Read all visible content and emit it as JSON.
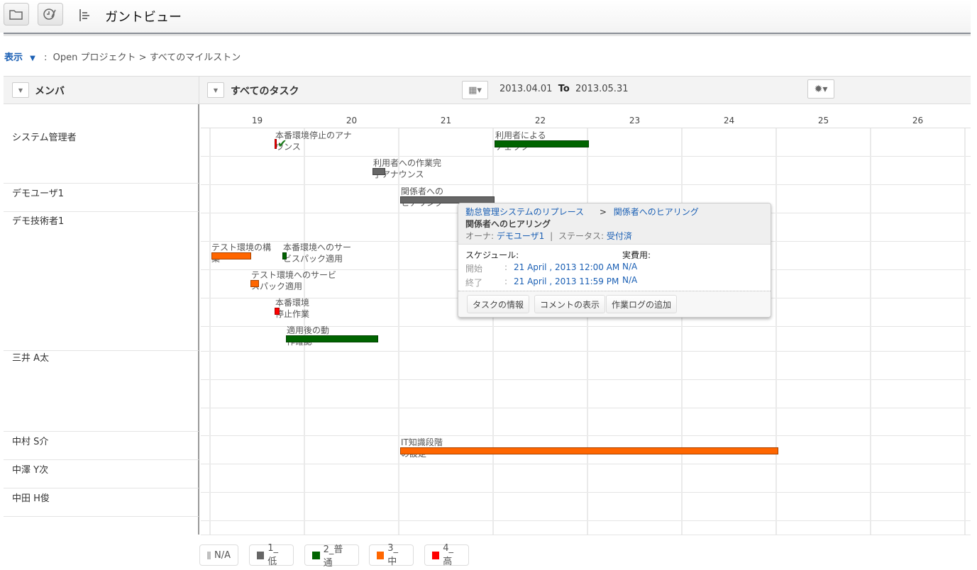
{
  "header": {
    "title": "ガントビュー"
  },
  "breadcrumb": {
    "view": "表示",
    "sep": ":",
    "project": "Open プロジェクト",
    "arrow": ">",
    "milestone": "すべてのマイルストン"
  },
  "toolbar": {
    "member_filter": "メンバ",
    "task_filter": "すべてのタスク",
    "date_from": "2013.04.01",
    "to": "To",
    "date_to": "2013.05.31"
  },
  "days": [
    "19",
    "20",
    "21",
    "22",
    "23",
    "24",
    "25",
    "26"
  ],
  "members": [
    "システム管理者",
    "デモユーザ1",
    "デモ技術者1",
    "三井 A太",
    "中村 S介",
    "中澤 Y次",
    "中田 H俊"
  ],
  "colors": {
    "na": "#c0c0c0",
    "low": "#666666",
    "normal": "#006400",
    "medium": "#ff6600",
    "high": "#ff0000"
  },
  "tasks": [
    {
      "label": "本番環境停止のアナウンス",
      "priority": "high",
      "milestone": true
    },
    {
      "label": "利用者への作業完了アナウンス",
      "priority": "low"
    },
    {
      "label": "利用者によるチェック",
      "priority": "normal"
    },
    {
      "label": "関係者へのヒアリング",
      "priority": "low"
    },
    {
      "label": "テスト環境の構築",
      "priority": "medium"
    },
    {
      "label": "本番環境へのサービスパック適用",
      "priority": "normal"
    },
    {
      "label": "テスト環境へのサービスパック適用",
      "priority": "medium"
    },
    {
      "label": "本番環境停止作業",
      "priority": "high"
    },
    {
      "label": "適用後の動作確認",
      "priority": "normal"
    },
    {
      "label": "IT知識段階の設定",
      "priority": "medium"
    }
  ],
  "tooltip": {
    "project": "勤怠管理システムのリプレース",
    "arrow": ">",
    "task_link": "関係者へのヒアリング",
    "title": "関係者へのヒアリング",
    "owner_label": "オーナ:",
    "owner": "デモユーザ1",
    "pipe": "|",
    "status_label": "ステータス:",
    "status": "受付済",
    "schedule_label": "スケジュール:",
    "cost_label": "実費用:",
    "start_label": "開始",
    "end_label": "終了",
    "colon": ":",
    "start": "21 April , 2013 12:00 AM",
    "end": "21 April , 2013 11:59 PM",
    "start_cost": "N/A",
    "end_cost": "N/A",
    "buttons": [
      "タスクの情報",
      "コメントの表示",
      "作業ログの追加"
    ]
  },
  "legend": [
    "N/A",
    "1_低",
    "2_普通",
    "3_中",
    "4_高"
  ]
}
